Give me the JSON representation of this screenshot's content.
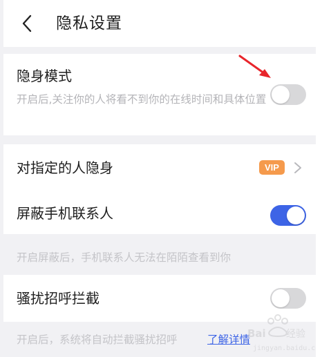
{
  "header": {
    "title": "隐私设置",
    "back_icon": "chevron-left-icon"
  },
  "stealth": {
    "title": "隐身模式",
    "description": "开启后,关注你的人将看不到你的在线时间和具体位置",
    "enabled": false
  },
  "hide_from": {
    "title": "对指定的人隐身",
    "badge": "VIP",
    "badge_color": "#f59a4c"
  },
  "block_contacts": {
    "title": "屏蔽手机联系人",
    "enabled": true,
    "note": "开启屏蔽后，手机联系人无法在陌陌查看到你"
  },
  "harass": {
    "title": "骚扰招呼拦截",
    "enabled": false,
    "note": "开启后，系统将自动拦截骚扰招呼",
    "link": "了解详情"
  },
  "watermark": {
    "text": "Bai经验"
  },
  "colors": {
    "accent": "#3d64e6",
    "toggle_off": "#d8d8da",
    "background": "#f1f1f4",
    "annotation_arrow": "#e8252b"
  }
}
